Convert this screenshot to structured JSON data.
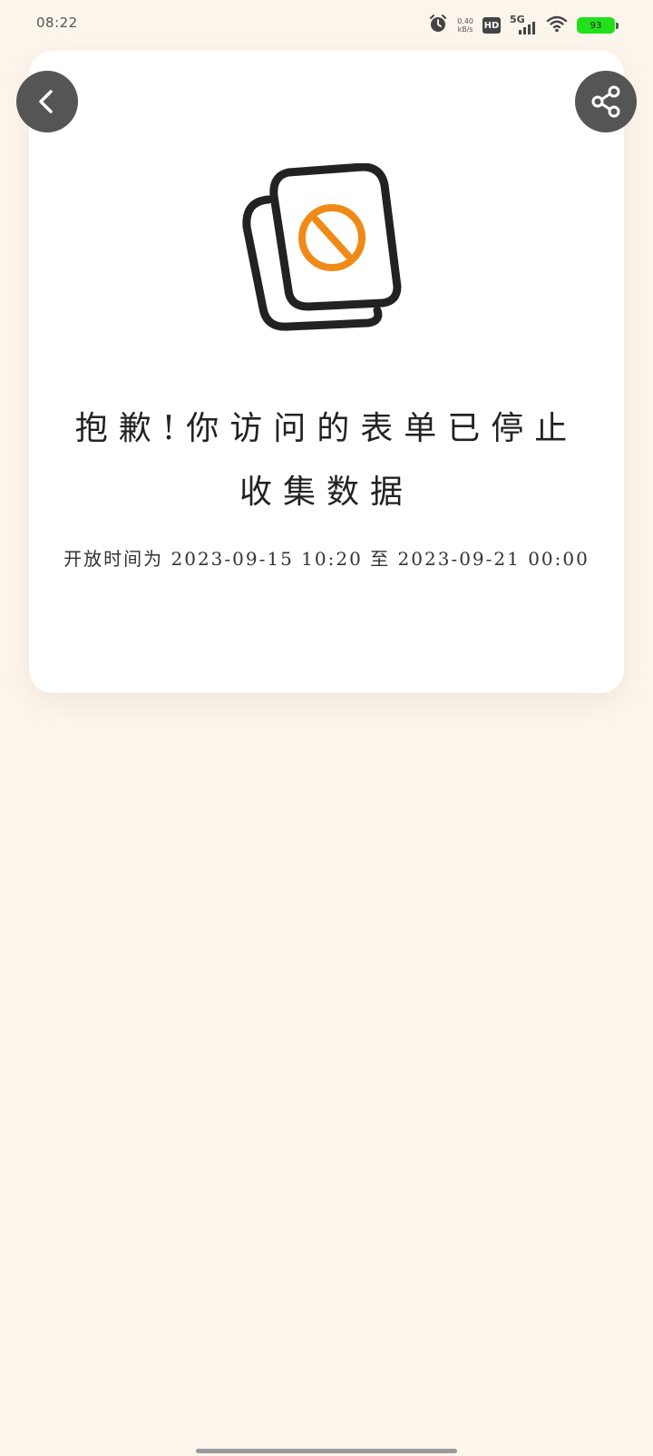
{
  "status_bar": {
    "time": "08:22",
    "net_speed_value": "0.40",
    "net_speed_unit": "kB/s",
    "hd_label": "HD",
    "network_label": "5G",
    "battery_level": "93",
    "battery_color": "#22e11a"
  },
  "card": {
    "message": "抱歉!你访问的表单已停止收集数据",
    "open_period": "开放时间为 2023-09-15 10:20 至 2023-09-21 00:00"
  },
  "icons": {
    "back": "chevron-left-icon",
    "share": "share-icon",
    "illustration": "form-closed-icon"
  },
  "colors": {
    "background": "#fcf5ec",
    "accent": "#f08a17",
    "button": "#555555"
  }
}
